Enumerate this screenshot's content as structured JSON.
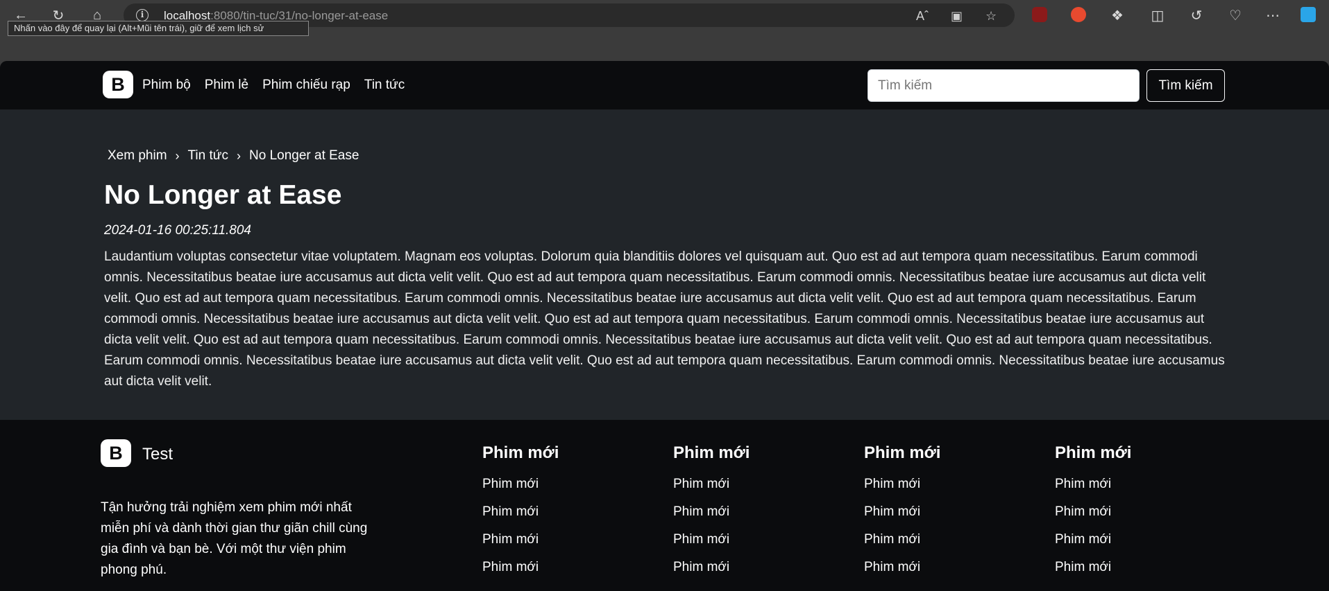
{
  "browser": {
    "url_host": "localhost",
    "url_path": ":8080/tin-tuc/31/no-longer-at-ease",
    "tooltip": "Nhấn vào đây để quay lại (Alt+Mũi tên trái), giữ để xem lịch sử"
  },
  "navbar": {
    "logo": "B",
    "links": [
      "Phim bộ",
      "Phim lẻ",
      "Phim chiếu rạp",
      "Tin tức"
    ],
    "search_placeholder": "Tìm kiếm",
    "search_button": "Tìm kiếm"
  },
  "breadcrumb": [
    "Xem phim",
    "Tin tức",
    "No Longer at Ease"
  ],
  "article": {
    "title": "No Longer at Ease",
    "date": "2024-01-16 00:25:11.804",
    "body": "Laudantium voluptas consectetur vitae voluptatem. Magnam eos voluptas. Dolorum quia blanditiis dolores vel quisquam aut. Quo est ad aut tempora quam necessitatibus. Earum commodi omnis. Necessitatibus beatae iure accusamus aut dicta velit velit. Quo est ad aut tempora quam necessitatibus. Earum commodi omnis. Necessitatibus beatae iure accusamus aut dicta velit velit. Quo est ad aut tempora quam necessitatibus. Earum commodi omnis. Necessitatibus beatae iure accusamus aut dicta velit velit. Quo est ad aut tempora quam necessitatibus. Earum commodi omnis. Necessitatibus beatae iure accusamus aut dicta velit velit. Quo est ad aut tempora quam necessitatibus. Earum commodi omnis. Necessitatibus beatae iure accusamus aut dicta velit velit. Quo est ad aut tempora quam necessitatibus. Earum commodi omnis. Necessitatibus beatae iure accusamus aut dicta velit velit. Quo est ad aut tempora quam necessitatibus. Earum commodi omnis. Necessitatibus beatae iure accusamus aut dicta velit velit. Quo est ad aut tempora quam necessitatibus. Earum commodi omnis. Necessitatibus beatae iure accusamus aut dicta velit velit."
  },
  "footer": {
    "logo": "B",
    "brand": "Test",
    "description": "Tận hưởng trải nghiệm xem phim mới nhất miễn phí và dành thời gian thư giãn chill cùng gia đình và bạn bè. Với một thư viện phim phong phú.",
    "columns": [
      {
        "heading": "Phim mới",
        "items": [
          "Phim mới",
          "Phim mới",
          "Phim mới",
          "Phim mới"
        ]
      },
      {
        "heading": "Phim mới",
        "items": [
          "Phim mới",
          "Phim mới",
          "Phim mới",
          "Phim mới"
        ]
      },
      {
        "heading": "Phim mới",
        "items": [
          "Phim mới",
          "Phim mới",
          "Phim mới",
          "Phim mới"
        ]
      },
      {
        "heading": "Phim mới",
        "items": [
          "Phim mới",
          "Phim mới",
          "Phim mới",
          "Phim mới"
        ]
      }
    ]
  }
}
